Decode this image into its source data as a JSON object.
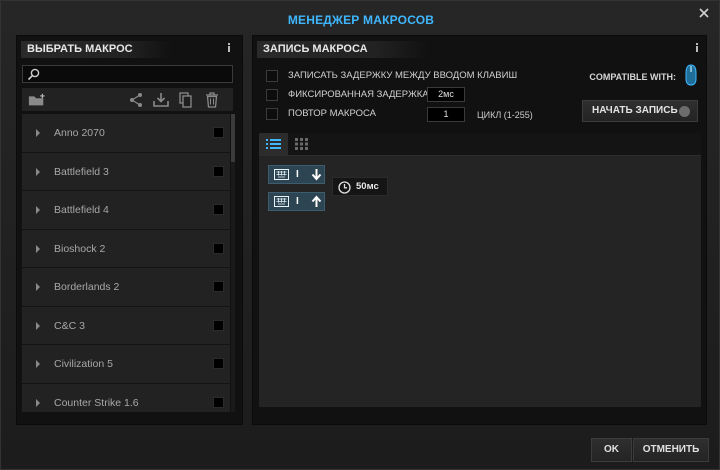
{
  "window": {
    "title": "МЕНЕДЖЕР МАКРОСОВ"
  },
  "left": {
    "header": "ВЫБРАТЬ МАКРОС",
    "search": {
      "value": "",
      "placeholder": ""
    },
    "macros": [
      {
        "label": "Anno 2070"
      },
      {
        "label": "Battlefield 3"
      },
      {
        "label": "Battlefield 4"
      },
      {
        "label": "Bioshock 2"
      },
      {
        "label": "Borderlands 2"
      },
      {
        "label": "C&C 3"
      },
      {
        "label": "Civilization 5"
      },
      {
        "label": "Counter Strike 1.6"
      }
    ]
  },
  "right": {
    "header": "ЗАПИСЬ МАКРОСА",
    "options": {
      "record_delay": "ЗАПИСАТЬ ЗАДЕРЖКУ МЕЖДУ ВВОДОМ КЛАВИШ",
      "fixed_delay": "ФИКСИРОВАННАЯ ЗАДЕРЖКА",
      "fixed_delay_value": "2мс",
      "repeat": "ПОВТОР МАКРОСА",
      "repeat_value": "1",
      "cycle_label": "ЦИКЛ (1-255)"
    },
    "compatible": "COMPATIBLE WITH:",
    "record_button": "НАЧАТЬ ЗАПИСЬ",
    "events": {
      "key1": "I",
      "key2": "I",
      "delay": "50мс"
    }
  },
  "footer": {
    "ok": "OK",
    "cancel": "ОТМЕНИТЬ"
  },
  "colors": {
    "accent": "#3fb7ff",
    "key_bg": "#2d4552"
  }
}
